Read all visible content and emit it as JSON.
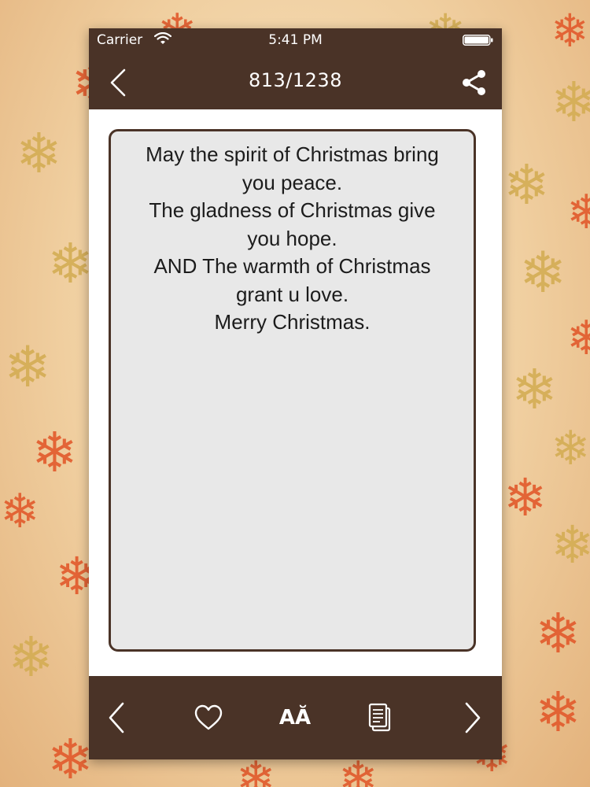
{
  "status_bar": {
    "carrier": "Carrier",
    "time": "5:41 PM"
  },
  "nav": {
    "title": "813/1238",
    "back_icon": "chevron-left-icon",
    "share_icon": "share-icon"
  },
  "message": {
    "lines": [
      "May the spirit of Christmas bring",
      "you peace.",
      "The gladness of Christmas give",
      "you hope.",
      "AND The warmth of Christmas",
      "grant u love.",
      "Merry Christmas."
    ]
  },
  "toolbar": {
    "font_size_label": "AĂ",
    "icons": [
      "chevron-left-icon",
      "heart-icon",
      "font-size-icon",
      "copy-icon",
      "chevron-right-icon"
    ]
  },
  "colors": {
    "bar": "#4a3327",
    "card": "#e8e8e8",
    "snow_red": "#e25a2c",
    "snow_gold": "#d4ad54"
  }
}
